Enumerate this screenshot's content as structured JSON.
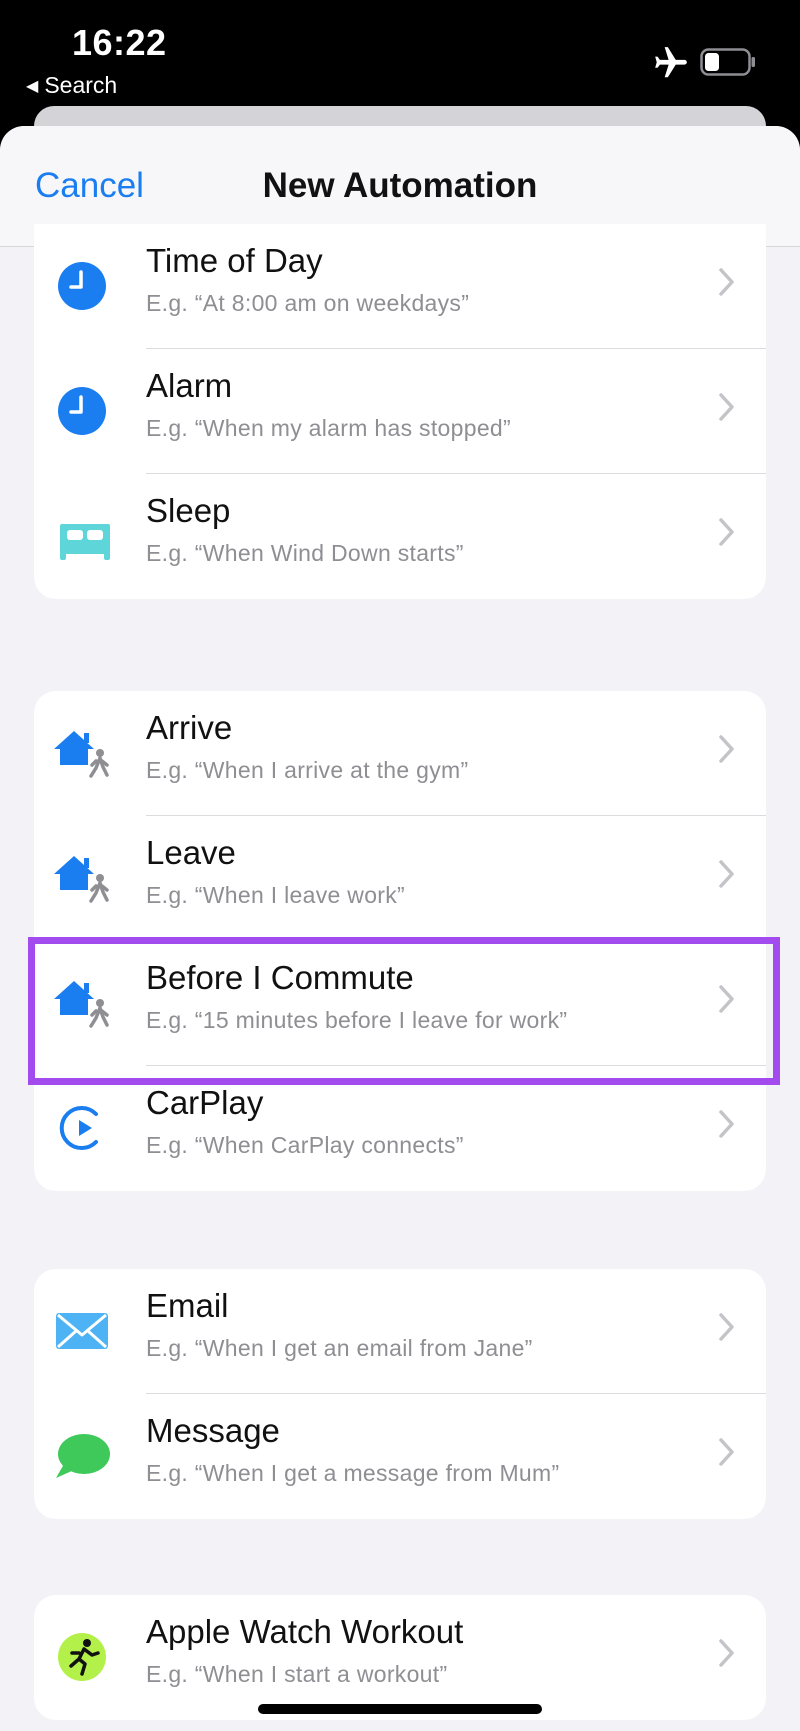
{
  "status_bar": {
    "time": "16:22",
    "back_label": "Search"
  },
  "nav": {
    "cancel_label": "Cancel",
    "title": "New Automation"
  },
  "groups": [
    {
      "rows": [
        {
          "title": "Time of Day",
          "subtitle": "E.g. “At 8:00 am on weekdays”",
          "icon": "clock-icon"
        },
        {
          "title": "Alarm",
          "subtitle": "E.g. “When my alarm has stopped”",
          "icon": "alarm-clock-icon"
        },
        {
          "title": "Sleep",
          "subtitle": "E.g. “When Wind Down starts”",
          "icon": "bed-icon"
        }
      ]
    },
    {
      "rows": [
        {
          "title": "Arrive",
          "subtitle": "E.g. “When I arrive at the gym”",
          "icon": "house-walker-icon"
        },
        {
          "title": "Leave",
          "subtitle": "E.g. “When I leave work”",
          "icon": "house-walker-icon"
        },
        {
          "title": "Before I Commute",
          "subtitle": "E.g. “15 minutes before I leave for work”",
          "icon": "house-walker-icon"
        },
        {
          "title": "CarPlay",
          "subtitle": "E.g. “When CarPlay connects”",
          "icon": "carplay-icon"
        }
      ]
    },
    {
      "rows": [
        {
          "title": "Email",
          "subtitle": "E.g. “When I get an email from Jane”",
          "icon": "mail-envelope-icon"
        },
        {
          "title": "Message",
          "subtitle": "E.g. “When I get a message from Mum”",
          "icon": "message-bubble-icon"
        }
      ]
    },
    {
      "rows": [
        {
          "title": "Apple Watch Workout",
          "subtitle": "E.g. “When I start a workout”",
          "icon": "workout-runner-icon"
        }
      ]
    }
  ],
  "colors": {
    "accent_blue": "#1a7ef0",
    "sleep_teal": "#5ed6d9",
    "mail_blue": "#4db3f5",
    "message_green": "#3ec95a",
    "workout_green": "#b4f04a",
    "highlight_purple": "#a24cf0",
    "chevron_gray": "#c4c4c8"
  }
}
